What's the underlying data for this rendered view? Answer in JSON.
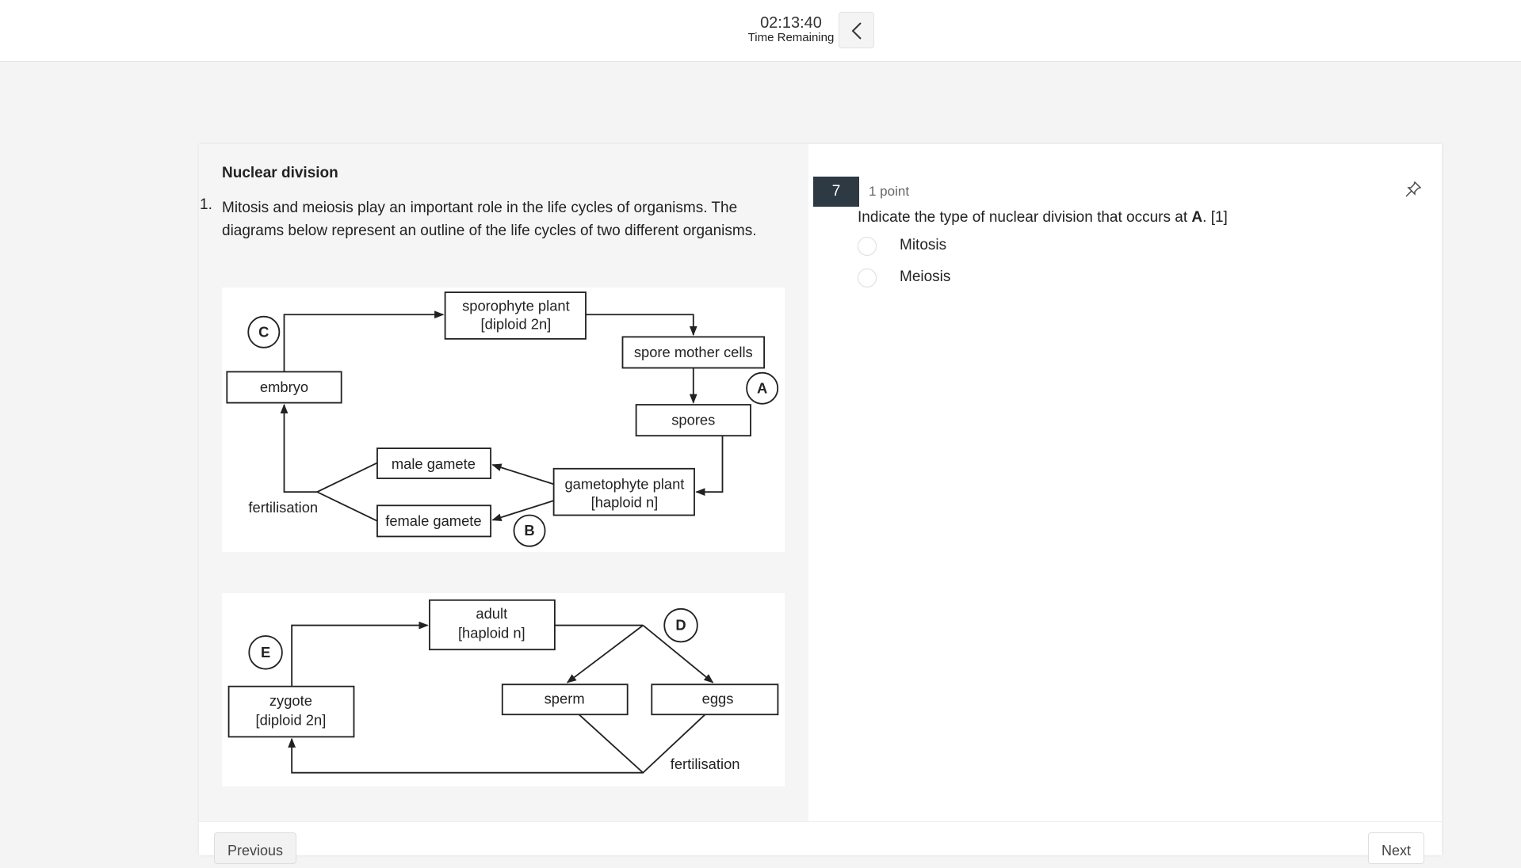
{
  "header": {
    "time": "02:13:40",
    "time_label": "Time Remaining",
    "back_icon": "chevron-left-icon"
  },
  "passage": {
    "title": "Nuclear division",
    "number": "1.",
    "text": "Mitosis and meiosis play an important role in the life cycles of organisms. The diagrams below represent an outline of the life cycles of two different organisms.",
    "diagram1": {
      "sporophyte_1": "sporophyte plant",
      "sporophyte_2": "[diploid 2n]",
      "spore_mother": "spore mother cells",
      "spores": "spores",
      "gametophyte_1": "gametophyte plant",
      "gametophyte_2": "[haploid n]",
      "male": "male gamete",
      "female": "female gamete",
      "embryo": "embryo",
      "fertilisation": "fertilisation",
      "A": "A",
      "B": "B",
      "C": "C"
    },
    "diagram2": {
      "adult_1": "adult",
      "adult_2": "[haploid n]",
      "sperm": "sperm",
      "eggs": "eggs",
      "zygote_1": "zygote",
      "zygote_2": "[diploid 2n]",
      "fertilisation": "fertilisation",
      "D": "D",
      "E": "E"
    }
  },
  "question": {
    "number": "7",
    "points": "1 point",
    "text_before": "Indicate the type of nuclear division that occurs at ",
    "text_bold": "A",
    "text_after": ". [1]",
    "options": [
      {
        "label": "Mitosis",
        "selected": false
      },
      {
        "label": "Meiosis",
        "selected": false
      }
    ],
    "pin_icon": "pin-icon"
  },
  "footer": {
    "previous": "Previous",
    "next": "Next"
  }
}
